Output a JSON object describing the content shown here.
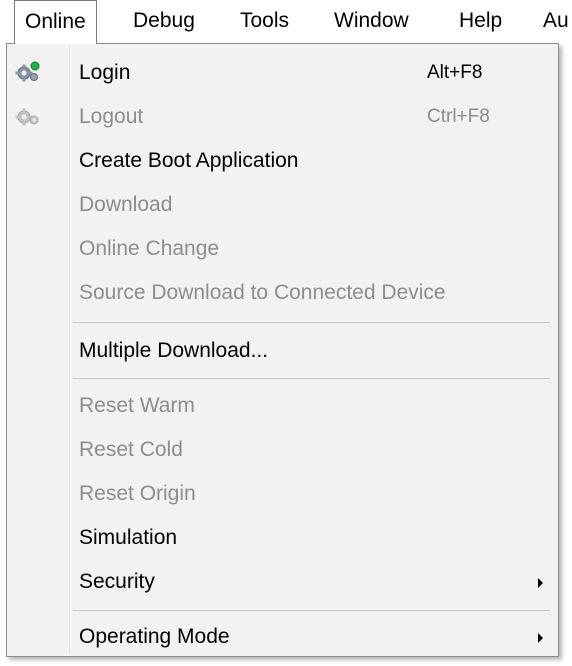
{
  "menubar": {
    "items": [
      {
        "label": "Online"
      },
      {
        "label": "Debug"
      },
      {
        "label": "Tools"
      },
      {
        "label": "Window"
      },
      {
        "label": "Help"
      },
      {
        "label": "Au"
      }
    ]
  },
  "dropdown": {
    "items": [
      {
        "label": "Login",
        "shortcut": "Alt+F8",
        "enabled": true,
        "icon": "login-gears-icon"
      },
      {
        "label": "Logout",
        "shortcut": "Ctrl+F8",
        "enabled": false,
        "icon": "logout-gears-icon"
      },
      {
        "label": "Create Boot Application",
        "enabled": true
      },
      {
        "label": "Download",
        "enabled": false
      },
      {
        "label": "Online Change",
        "enabled": false
      },
      {
        "label": "Source Download to Connected Device",
        "enabled": false
      },
      {
        "label": "Multiple Download...",
        "enabled": true
      },
      {
        "label": "Reset Warm",
        "enabled": false
      },
      {
        "label": "Reset Cold",
        "enabled": false
      },
      {
        "label": "Reset Origin",
        "enabled": false
      },
      {
        "label": "Simulation",
        "enabled": true
      },
      {
        "label": "Security",
        "enabled": true,
        "submenu": true
      },
      {
        "label": "Operating Mode",
        "enabled": true,
        "submenu": true
      }
    ]
  },
  "colors": {
    "menu_bg": "#f2f2f2",
    "disabled_text": "#8d8d8d",
    "separator": "#c8c8c8",
    "login_indicator": "#22b14c"
  }
}
